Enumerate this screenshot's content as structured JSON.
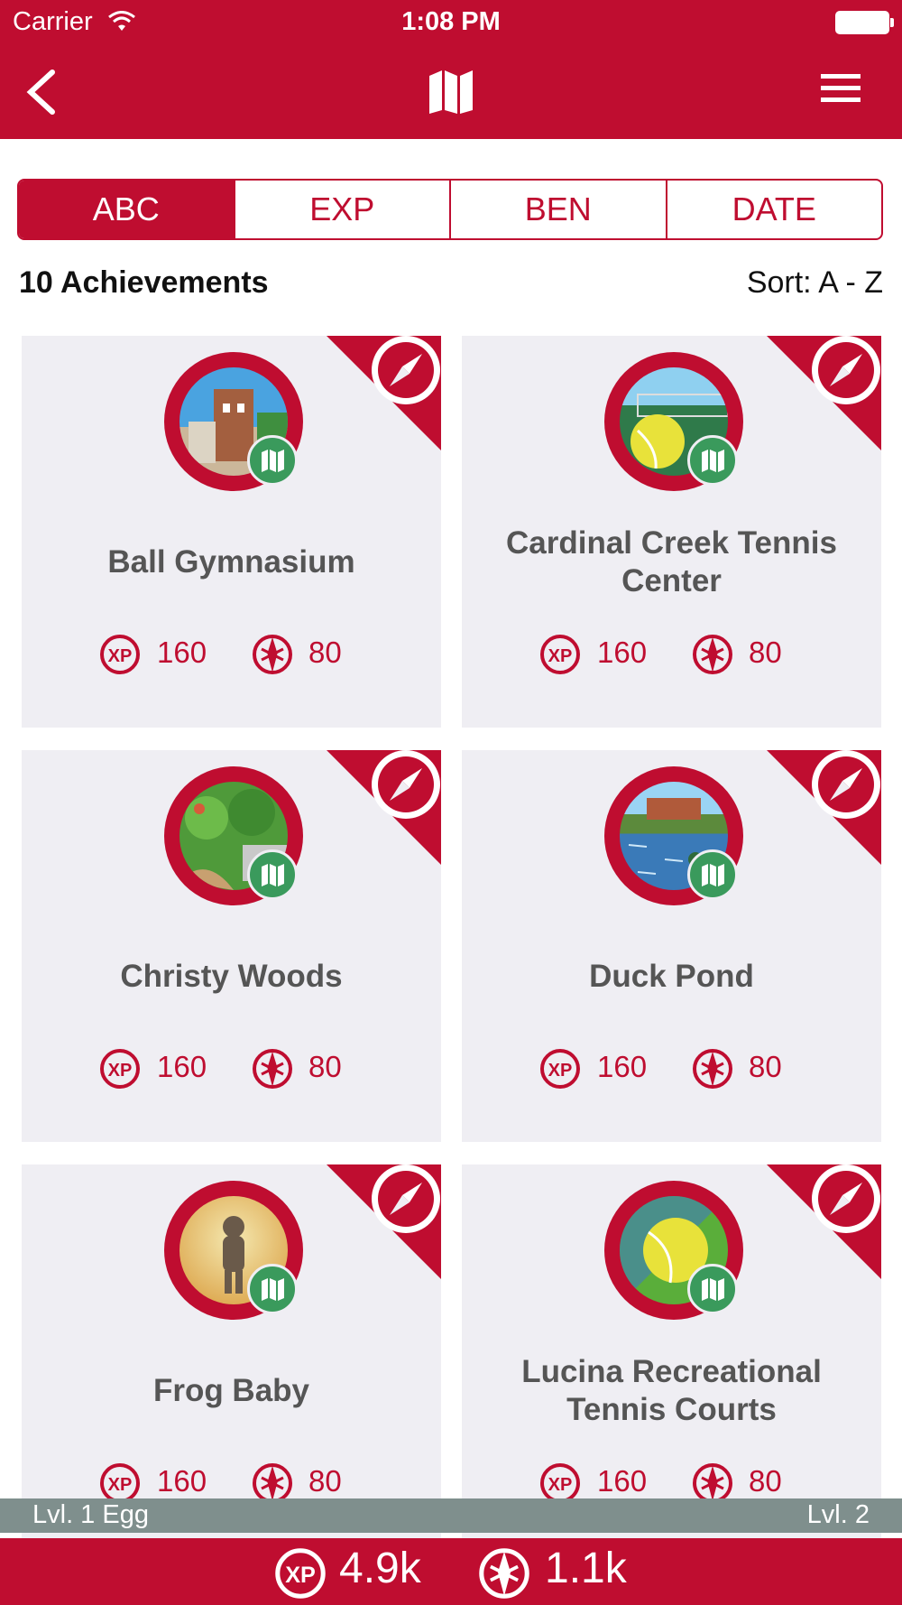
{
  "status": {
    "carrier": "Carrier",
    "time": "1:08 PM"
  },
  "colors": {
    "accent": "#bf0d30",
    "card_bg": "#efeef3",
    "map_badge": "#3a9a5c",
    "level_bar": "#7f8f8d"
  },
  "nav": {
    "back_icon": "chevron-left-icon",
    "map_icon": "map-icon",
    "menu_icon": "hamburger-icon"
  },
  "tabs": [
    {
      "label": "ABC",
      "active": true
    },
    {
      "label": "EXP",
      "active": false
    },
    {
      "label": "BEN",
      "active": false
    },
    {
      "label": "DATE",
      "active": false
    }
  ],
  "list_header": {
    "count": "10 Achievements",
    "sort": "Sort: A - Z"
  },
  "achievements": [
    {
      "name": "Ball Gymnasium",
      "xp": "160",
      "ben": "80"
    },
    {
      "name": "Cardinal Creek Tennis Center",
      "xp": "160",
      "ben": "80"
    },
    {
      "name": "Christy Woods",
      "xp": "160",
      "ben": "80"
    },
    {
      "name": "Duck Pond",
      "xp": "160",
      "ben": "80"
    },
    {
      "name": "Frog Baby",
      "xp": "160",
      "ben": "80"
    },
    {
      "name": "Lucina Recreational Tennis Courts",
      "xp": "160",
      "ben": "80"
    }
  ],
  "level": {
    "current": "Lvl. 1 Egg",
    "next": "Lvl. 2"
  },
  "totals": {
    "xp": "4.9k",
    "ben": "1.1k"
  }
}
